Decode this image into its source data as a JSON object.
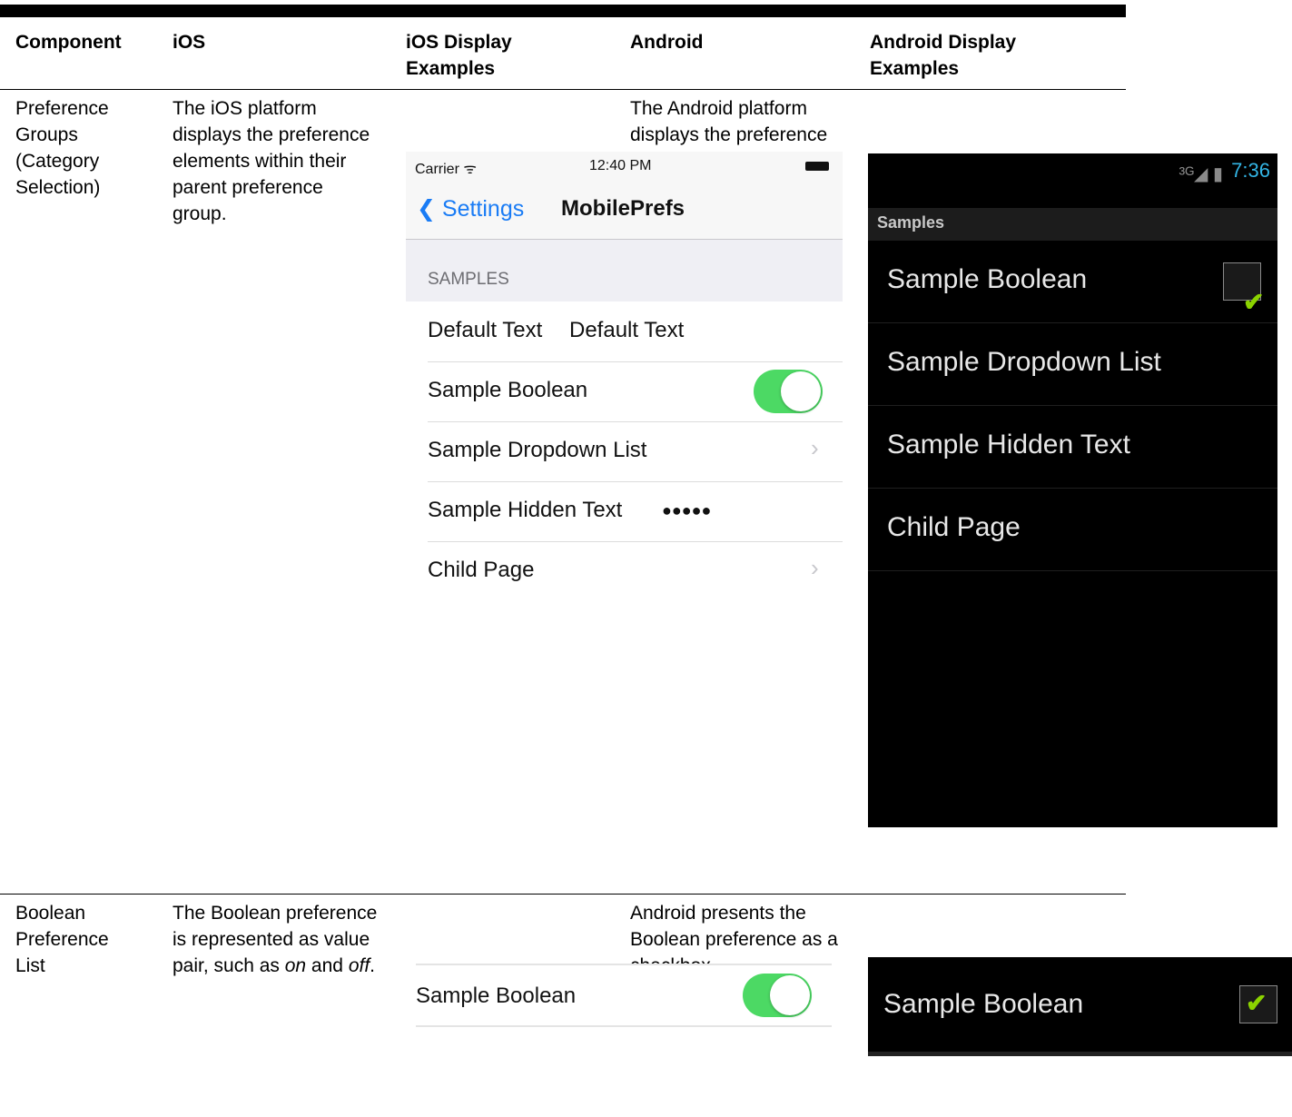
{
  "headers": {
    "component": "Component",
    "ios": "iOS",
    "ios_display": "iOS Display Examples",
    "android": "Android",
    "android_display": "Android Display Examples"
  },
  "rows": [
    {
      "component": "Preference Groups (Category Selection)",
      "ios": "The iOS platform displays the preference elements within their parent preference group.",
      "android": "The Android platform displays the preference elements within their parent preference group."
    },
    {
      "component": "Boolean Preference List",
      "ios_pre": "The Boolean preference is represented as value pair, such as ",
      "ios_on": "on",
      "ios_mid": " and ",
      "ios_off": "off",
      "ios_post": ".",
      "android": "Android presents the Boolean preference as a checkbox."
    }
  ],
  "ios_screen": {
    "carrier": "Carrier ᯤ",
    "time": "12:40 PM",
    "back_label": "❮ Settings",
    "nav_title": "MobilePrefs",
    "section": "SAMPLES",
    "items": {
      "default_text_label": "Default Text",
      "default_text_value": "Default Text",
      "boolean_label": "Sample Boolean",
      "dropdown_label": "Sample Dropdown List",
      "hidden_label": "Sample Hidden Text",
      "hidden_value": "●●●●●",
      "child_label": "Child Page"
    },
    "chevron": "›",
    "toggle_on": true,
    "toggle_color": "#4cd964",
    "link_color": "#1a7cf5"
  },
  "android_screen": {
    "signal": "³ᴳ◢ ▮",
    "clock": "7:36",
    "category": "Samples",
    "items": [
      "Sample Boolean",
      "Sample Dropdown List",
      "Sample Hidden Text",
      "Child Page"
    ],
    "check": "✔",
    "clock_color": "#33b5e5",
    "check_color": "#8bd300"
  },
  "ios_boolean_example": {
    "label": "Sample Boolean",
    "toggle_on": true
  },
  "android_boolean_example": {
    "label": "Sample Boolean",
    "check": "✔"
  }
}
